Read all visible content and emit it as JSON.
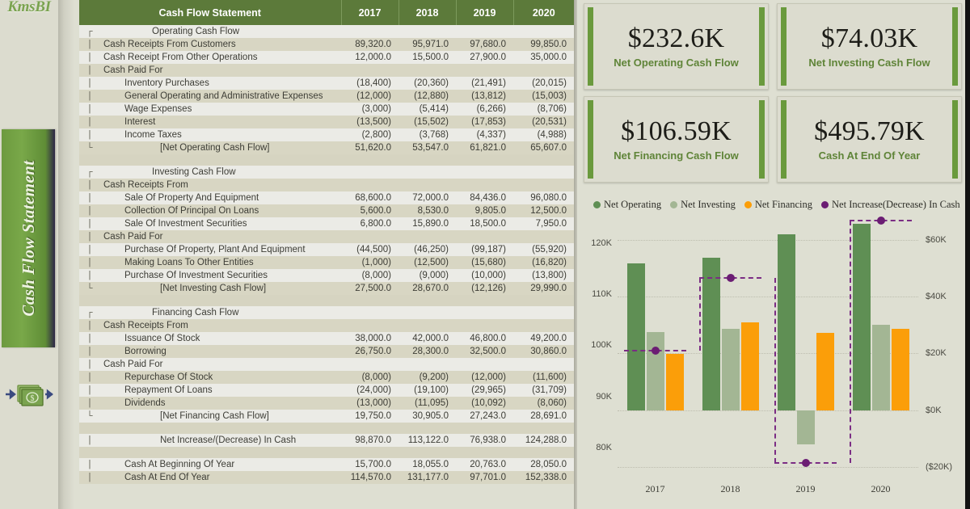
{
  "app": {
    "logo": "KmsBI",
    "nav_tab": "Cash Flow Statement",
    "cash_icon": "money-flow-icon"
  },
  "colors": {
    "header_green": "#5c7a3a",
    "accent_green": "#6a9a3d",
    "net_operating": "#5f8f54",
    "net_investing": "#a3b694",
    "net_financing": "#fb9e09",
    "net_increase": "#6b1d73",
    "panel_bg": "#dedfd2",
    "row_light": "#ebebe6",
    "row_dark": "#d8d6c3"
  },
  "table": {
    "title": "Cash Flow Statement",
    "columns": [
      "Cash Flow Statement",
      "2017",
      "2018",
      "2019",
      "2020"
    ],
    "rows": [
      {
        "tree": "┌",
        "level": 0,
        "label": "Operating  Cash Flow",
        "values": [
          "",
          "",
          "",
          ""
        ],
        "shade": "light"
      },
      {
        "tree": "|",
        "level": 1,
        "label": "Cash Receipts From Customers",
        "values": [
          "89,320.0",
          "95,971.0",
          "97,680.0",
          "99,850.0"
        ],
        "shade": "dark"
      },
      {
        "tree": "|",
        "level": 1,
        "label": "Cash Receipt From Other Operations",
        "values": [
          "12,000.0",
          "15,500.0",
          "27,900.0",
          "35,000.0"
        ],
        "shade": "light"
      },
      {
        "tree": "|",
        "level": 1,
        "label": "Cash Paid For",
        "values": [
          "",
          "",
          "",
          ""
        ],
        "shade": "dark"
      },
      {
        "tree": "|",
        "level": 2,
        "label": "Inventory Purchases",
        "values": [
          "(18,400)",
          "(20,360)",
          "(21,491)",
          "(20,015)"
        ],
        "shade": "light"
      },
      {
        "tree": "|",
        "level": 2,
        "label": "General Operating and Administrative Expenses",
        "values": [
          "(12,000)",
          "(12,880)",
          "(13,812)",
          "(15,003)"
        ],
        "shade": "dark"
      },
      {
        "tree": "|",
        "level": 2,
        "label": "Wage Expenses",
        "values": [
          "(3,000)",
          "(5,414)",
          "(6,266)",
          "(8,706)"
        ],
        "shade": "light"
      },
      {
        "tree": "|",
        "level": 2,
        "label": "Interest",
        "values": [
          "(13,500)",
          "(15,502)",
          "(17,853)",
          "(20,531)"
        ],
        "shade": "dark"
      },
      {
        "tree": "|",
        "level": 2,
        "label": "Income Taxes",
        "values": [
          "(2,800)",
          "(3,768)",
          "(4,337)",
          "(4,988)"
        ],
        "shade": "light"
      },
      {
        "tree": "└",
        "level": 3,
        "label": "[Net Operating Cash Flow]",
        "values": [
          "51,620.0",
          "53,547.0",
          "61,821.0",
          "65,607.0"
        ],
        "shade": "dark"
      },
      {
        "tree": "",
        "level": 1,
        "label": "",
        "values": [
          "",
          "",
          "",
          ""
        ],
        "shade": "blank"
      },
      {
        "tree": "┌",
        "level": 0,
        "label": "Investing  Cash Flow",
        "values": [
          "",
          "",
          "",
          ""
        ],
        "shade": "light"
      },
      {
        "tree": "|",
        "level": 1,
        "label": "Cash Receipts From",
        "values": [
          "",
          "",
          "",
          ""
        ],
        "shade": "dark"
      },
      {
        "tree": "|",
        "level": 2,
        "label": "Sale Of Property And Equipment",
        "values": [
          "68,600.0",
          "72,000.0",
          "84,436.0",
          "96,080.0"
        ],
        "shade": "light"
      },
      {
        "tree": "|",
        "level": 2,
        "label": "Collection Of Principal On Loans",
        "values": [
          "5,600.0",
          "8,530.0",
          "9,805.0",
          "12,500.0"
        ],
        "shade": "dark"
      },
      {
        "tree": "|",
        "level": 2,
        "label": "Sale Of Investment Securities",
        "values": [
          "6,800.0",
          "15,890.0",
          "18,500.0",
          "7,950.0"
        ],
        "shade": "light"
      },
      {
        "tree": "|",
        "level": 1,
        "label": "Cash Paid For",
        "values": [
          "",
          "",
          "",
          ""
        ],
        "shade": "dark"
      },
      {
        "tree": "|",
        "level": 2,
        "label": "Purchase Of Property, Plant And Equipment",
        "values": [
          "(44,500)",
          "(46,250)",
          "(99,187)",
          "(55,920)"
        ],
        "shade": "light"
      },
      {
        "tree": "|",
        "level": 2,
        "label": "Making Loans To Other Entities",
        "values": [
          "(1,000)",
          "(12,500)",
          "(15,680)",
          "(16,820)"
        ],
        "shade": "dark"
      },
      {
        "tree": "|",
        "level": 2,
        "label": "Purchase Of Investment Securities",
        "values": [
          "(8,000)",
          "(9,000)",
          "(10,000)",
          "(13,800)"
        ],
        "shade": "light"
      },
      {
        "tree": "└",
        "level": 3,
        "label": "[Net Investing Cash Flow]",
        "values": [
          "27,500.0",
          "28,670.0",
          "(12,126)",
          "29,990.0"
        ],
        "shade": "dark"
      },
      {
        "tree": "",
        "level": 1,
        "label": "",
        "values": [
          "",
          "",
          "",
          ""
        ],
        "shade": "blank"
      },
      {
        "tree": "┌",
        "level": 0,
        "label": "Financing Cash Flow",
        "values": [
          "",
          "",
          "",
          ""
        ],
        "shade": "light"
      },
      {
        "tree": "|",
        "level": 1,
        "label": "Cash Receipts From",
        "values": [
          "",
          "",
          "",
          ""
        ],
        "shade": "dark"
      },
      {
        "tree": "|",
        "level": 2,
        "label": "Issuance Of Stock",
        "values": [
          "38,000.0",
          "42,000.0",
          "46,800.0",
          "49,200.0"
        ],
        "shade": "light"
      },
      {
        "tree": "|",
        "level": 2,
        "label": "Borrowing",
        "values": [
          "26,750.0",
          "28,300.0",
          "32,500.0",
          "30,860.0"
        ],
        "shade": "dark"
      },
      {
        "tree": "|",
        "level": 1,
        "label": "Cash Paid For",
        "values": [
          "",
          "",
          "",
          ""
        ],
        "shade": "light"
      },
      {
        "tree": "|",
        "level": 2,
        "label": "Repurchase Of Stock",
        "values": [
          "(8,000)",
          "(9,200)",
          "(12,000)",
          "(11,600)"
        ],
        "shade": "dark"
      },
      {
        "tree": "|",
        "level": 2,
        "label": "Repayment Of Loans",
        "values": [
          "(24,000)",
          "(19,100)",
          "(29,965)",
          "(31,709)"
        ],
        "shade": "light"
      },
      {
        "tree": "|",
        "level": 2,
        "label": "Dividends",
        "values": [
          "(13,000)",
          "(11,095)",
          "(10,092)",
          "(8,060)"
        ],
        "shade": "dark"
      },
      {
        "tree": "└",
        "level": 3,
        "label": "[Net Financing Cash Flow]",
        "values": [
          "19,750.0",
          "30,905.0",
          "27,243.0",
          "28,691.0"
        ],
        "shade": "light"
      },
      {
        "tree": "",
        "level": 1,
        "label": "",
        "values": [
          "",
          "",
          "",
          ""
        ],
        "shade": "blank"
      },
      {
        "tree": "|",
        "level": 3,
        "label": "Net Increase/(Decrease) In Cash",
        "values": [
          "98,870.0",
          "113,122.0",
          "76,938.0",
          "124,288.0"
        ],
        "shade": "light"
      },
      {
        "tree": "",
        "level": 1,
        "label": "",
        "values": [
          "",
          "",
          "",
          ""
        ],
        "shade": "blank"
      },
      {
        "tree": "|",
        "level": 2,
        "label": "Cash At Beginning Of Year",
        "values": [
          "15,700.0",
          "18,055.0",
          "20,763.0",
          "28,050.0"
        ],
        "shade": "light"
      },
      {
        "tree": "|",
        "level": 2,
        "label": "Cash At End Of Year",
        "values": [
          "114,570.0",
          "131,177.0",
          "97,701.0",
          "152,338.0"
        ],
        "shade": "dark"
      }
    ]
  },
  "kpis": [
    {
      "value": "$232.6K",
      "label": "Net Operating Cash Flow"
    },
    {
      "value": "$74.03K",
      "label": "Net Investing Cash Flow"
    },
    {
      "value": "$106.59K",
      "label": "Net Financing Cash Flow"
    },
    {
      "value": "$495.79K",
      "label": "Cash At End Of Year"
    }
  ],
  "chart_data": {
    "type": "bar",
    "title": "",
    "xlabel": "",
    "ylabel": "",
    "grid": true,
    "legend_position": "top",
    "categories": [
      "2017",
      "2018",
      "2019",
      "2020"
    ],
    "legend": [
      {
        "name": "Net Operating",
        "color": "#5f8f54",
        "axis": "right"
      },
      {
        "name": "Net Investing",
        "color": "#a3b694",
        "axis": "right"
      },
      {
        "name": "Net Financing",
        "color": "#fb9e09",
        "axis": "right"
      },
      {
        "name": "Net Increase(Decrease) In Cash",
        "color": "#6b1d73",
        "axis": "left"
      }
    ],
    "series": [
      {
        "name": "Net Operating",
        "type": "bar",
        "color": "#5f8f54",
        "axis": "right",
        "values": [
          51620,
          53547,
          61821,
          65607
        ]
      },
      {
        "name": "Net Investing",
        "type": "bar",
        "color": "#a3b694",
        "axis": "right",
        "values": [
          27500,
          28670,
          -12126,
          29990
        ]
      },
      {
        "name": "Net Financing",
        "type": "bar",
        "color": "#fb9e09",
        "axis": "right",
        "values": [
          19750,
          30905,
          27243,
          28691
        ]
      },
      {
        "name": "Net Increase(Decrease) In Cash",
        "type": "line-step",
        "color": "#6b1d73",
        "axis": "left",
        "values": [
          98870,
          113122,
          76938,
          124288
        ]
      }
    ],
    "yaxis_left": {
      "ticks": [
        "80K",
        "90K",
        "100K",
        "110K",
        "120K"
      ],
      "tick_values": [
        80000,
        90000,
        100000,
        110000,
        120000
      ],
      "range": [
        74000,
        124500
      ]
    },
    "yaxis_right": {
      "ticks": [
        "($20K)",
        "$0K",
        "$20K",
        "$40K",
        "$60K"
      ],
      "tick_values": [
        -20000,
        0,
        20000,
        40000,
        60000
      ],
      "range": [
        -24000,
        67000
      ]
    }
  }
}
